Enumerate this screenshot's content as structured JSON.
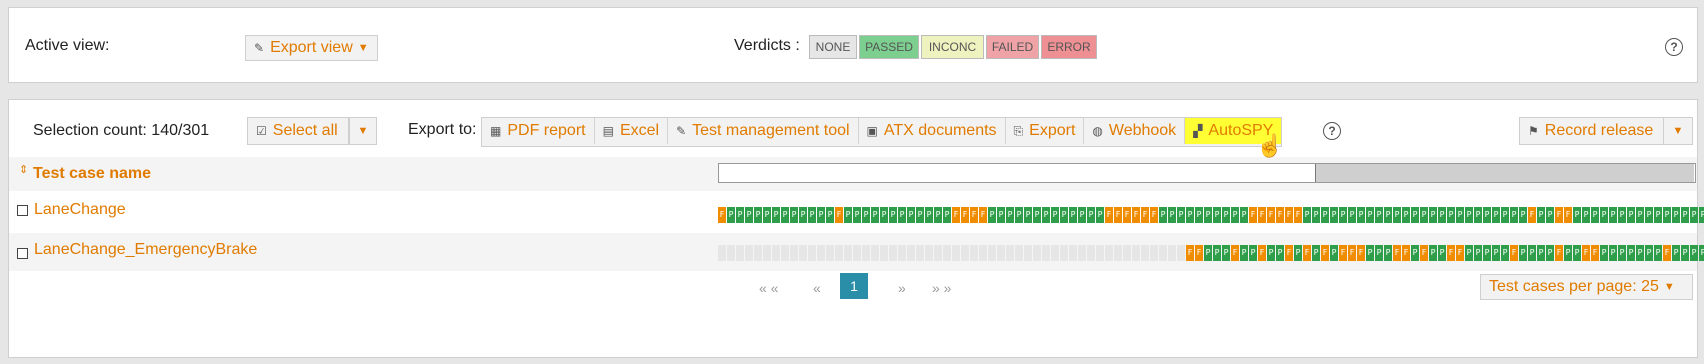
{
  "top": {
    "active_view_label": "Active view:",
    "export_view_label": "Export view",
    "verdicts_label": "Verdicts :",
    "verdicts": [
      {
        "label": "NONE",
        "color": "#e6e6e6"
      },
      {
        "label": "PASSED",
        "color": "#7ccf8f"
      },
      {
        "label": "INCONC",
        "color": "#eef2bf"
      },
      {
        "label": "FAILED",
        "color": "#f0a3a6"
      },
      {
        "label": "ERROR",
        "color": "#ee9093"
      }
    ],
    "help_glyph": "?"
  },
  "toolbar": {
    "selection_count": "Selection count: 140/301",
    "select_all_label": "Select all",
    "export_to_label": "Export to:",
    "export_items": [
      {
        "label": "PDF report",
        "icon": "pdf-icon"
      },
      {
        "label": "Excel",
        "icon": "excel-icon"
      },
      {
        "label": "Test management tool",
        "icon": "pencil-icon"
      },
      {
        "label": "ATX documents",
        "icon": "document-icon"
      },
      {
        "label": "Export",
        "icon": "export-icon"
      },
      {
        "label": "Webhook",
        "icon": "globe-icon"
      },
      {
        "label": "AutoSPY",
        "icon": "autospy-icon",
        "highlighted": true
      }
    ],
    "record_release_label": "Record release",
    "help_glyph": "?"
  },
  "table": {
    "column_header": "Test case name",
    "rows": [
      {
        "name": "LaneChange",
        "results": "FPPPPPPPPPPPPFPPPPPPPPPPPPFFFFPPPPPPPPPPPPPFFFFFFPPPPPPPPPPFFFFFFPPPPPPPPPPPPPPPPPPPPPPPPPFPPFFPPPPPPPPPPPPPPP"
      },
      {
        "name": "LaneChange_EmergencyBrake",
        "results": "NNNNNNNNNNNNNNNNNNNNNNNNNNNNNNNNNNNNNNNNNNNNNNNNNNNNFFPPPFPPFPPFPFPFPFFFPPPFFPFPPFFPPPPPFPPPPFPPFFPPPPPPPFPPPPF"
      }
    ]
  },
  "pager": {
    "first": "« «",
    "prev": "«",
    "current": "1",
    "next": "»",
    "last": "» »",
    "per_page_label": "Test cases per page: 25"
  },
  "colors": {
    "accent": "#e07b00",
    "passed_cell": "#2e9e4a",
    "failed_cell": "#f08c00",
    "highlight": "#ffff33",
    "current_page": "#2a8ea8"
  }
}
